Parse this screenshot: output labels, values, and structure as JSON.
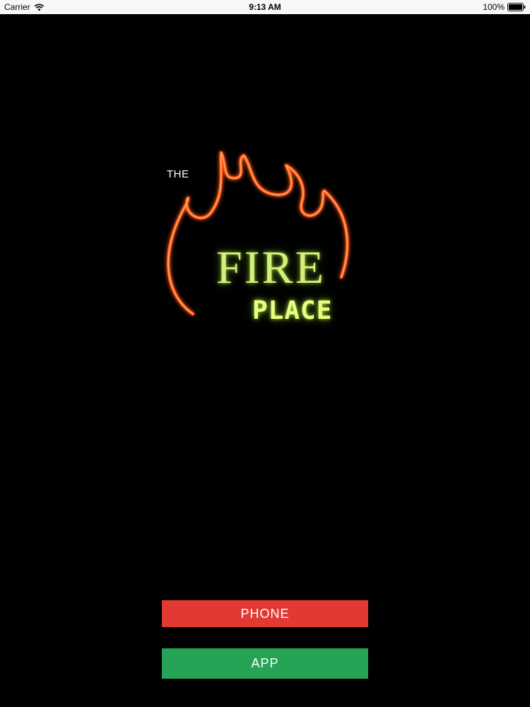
{
  "status_bar": {
    "carrier": "Carrier",
    "time": "9:13 AM",
    "battery": "100%",
    "icons": [
      "wifi-icon",
      "battery-icon"
    ]
  },
  "logo": {
    "line1": "THE",
    "line2": "FIRE",
    "line3": "PLACE",
    "flame_color": "#ff5a1e",
    "text_color": "#d4f07c"
  },
  "buttons": {
    "phone_label": "PHONE",
    "app_label": "APP",
    "phone_color": "#e23a33",
    "app_color": "#24a454"
  }
}
